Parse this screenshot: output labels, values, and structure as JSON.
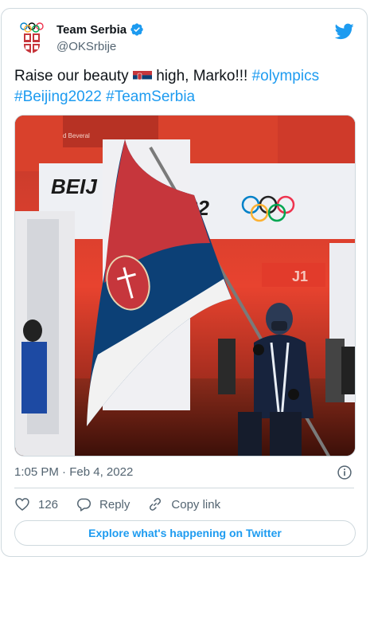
{
  "account": {
    "name": "Team Serbia",
    "handle": "@OKSrbije"
  },
  "tweet": {
    "text_before": "Raise our beauty",
    "text_after": " high, Marko!!! ",
    "hashtags": [
      "#olympics",
      "#Beijing2022",
      "#TeamSerbia"
    ],
    "photo_text": {
      "sign_left": "BEIJ",
      "sign_right": "22",
      "sign_red": "J1",
      "banner_small": "d Beveral"
    }
  },
  "meta": {
    "time": "1:05 PM",
    "separator": " · ",
    "date": "Feb 4, 2022"
  },
  "actions": {
    "like_count": "126",
    "reply_label": "Reply",
    "copy_label": "Copy link"
  },
  "explore_label": "Explore what's happening on Twitter",
  "colors": {
    "accent": "#1d9bf0",
    "muted": "#536471",
    "border": "#cfd9de"
  },
  "icons": [
    "olympic-committee-logo",
    "verified-icon",
    "twitter-bird-icon",
    "serbia-flag-icon",
    "info-icon",
    "heart-icon",
    "reply-icon",
    "link-icon"
  ]
}
